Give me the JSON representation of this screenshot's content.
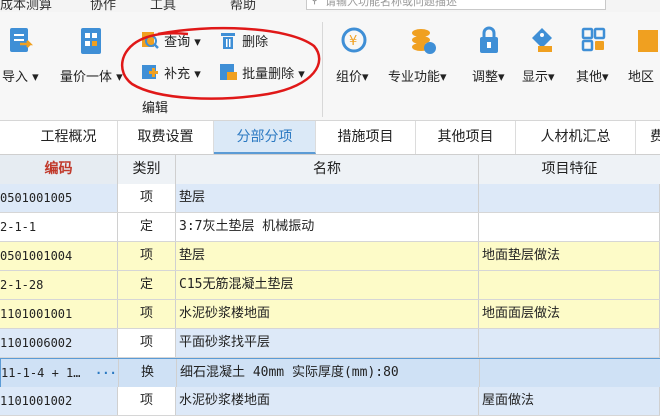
{
  "menubar": {
    "items": [
      "成本测算",
      "协作",
      "工具",
      "帮助"
    ],
    "search_placeholder": "请输入功能名称或问题描述"
  },
  "ribbon": {
    "buttons": {
      "import": "导入",
      "price_integrate": "量价一体",
      "query": "查询",
      "delete": "删除",
      "supplement": "补充",
      "batch_delete": "批量删除",
      "price_group": "组价",
      "professional": "专业功能",
      "adjust": "调整",
      "display": "显示",
      "other": "其他",
      "region": "地区"
    },
    "group_label": "编辑"
  },
  "tabs": [
    {
      "label": "工程概况"
    },
    {
      "label": "取费设置"
    },
    {
      "label": "分部分项"
    },
    {
      "label": "措施项目"
    },
    {
      "label": "其他项目"
    },
    {
      "label": "人材机汇总"
    },
    {
      "label": "费"
    }
  ],
  "table": {
    "headers": {
      "code": "编码",
      "type": "类别",
      "name": "名称",
      "feature": "项目特征"
    },
    "rows": [
      {
        "code": "0501001005",
        "type": "项",
        "name": "垫层",
        "feature": ""
      },
      {
        "code": "2-1-1",
        "type": "定",
        "name": "3:7灰土垫层 机械振动",
        "feature": ""
      },
      {
        "code": "0501001004",
        "type": "项",
        "name": "垫层",
        "feature": "地面垫层做法"
      },
      {
        "code": "2-1-28",
        "type": "定",
        "name": "C15无筋混凝土垫层",
        "feature": ""
      },
      {
        "code": "1101001001",
        "type": "项",
        "name": "水泥砂浆楼地面",
        "feature": "地面面层做法"
      },
      {
        "code": "1101006002",
        "type": "项",
        "name": "平面砂浆找平层",
        "feature": ""
      },
      {
        "code": "11-1-4 + 1…",
        "type": "换",
        "name": "细石混凝土 40mm  实际厚度(mm):80",
        "feature": "",
        "more": "···"
      },
      {
        "code": "1101001002",
        "type": "项",
        "name": "水泥砂浆楼地面",
        "feature": "屋面做法"
      }
    ]
  },
  "colors": {
    "accent": "#2b79c2",
    "annotation": "#e01818",
    "yellow_row": "#fdfbc8",
    "blue_row": "#dde9f8"
  }
}
